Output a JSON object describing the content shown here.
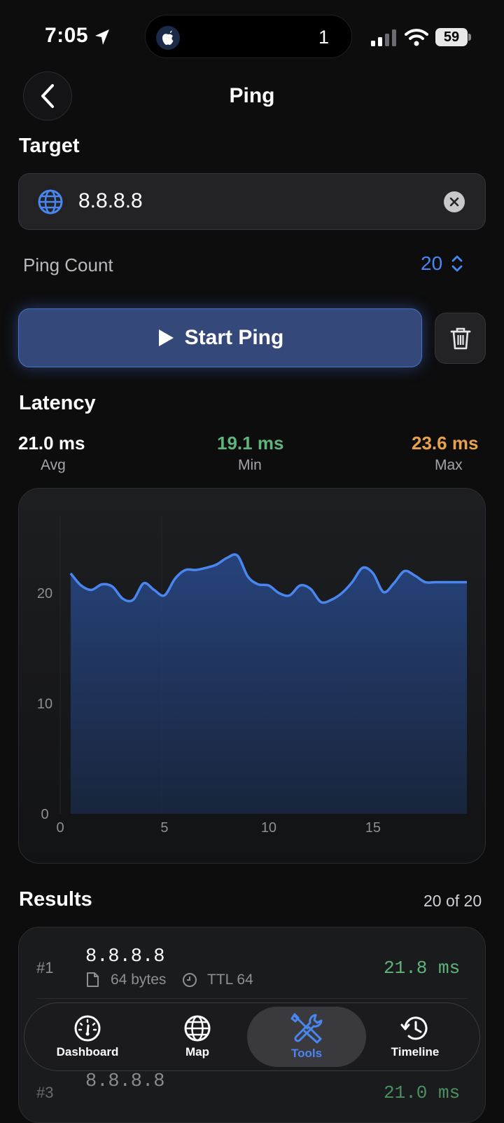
{
  "status": {
    "time": "7:05",
    "island_count": "1",
    "battery": "59"
  },
  "nav": {
    "title": "Ping"
  },
  "target": {
    "section": "Target",
    "value": "8.8.8.8"
  },
  "ping_count": {
    "label": "Ping Count",
    "value": "20"
  },
  "actions": {
    "start_label": "Start Ping"
  },
  "latency": {
    "section": "Latency",
    "avg": {
      "value": "21.0 ms",
      "label": "Avg",
      "color": "#ffffff"
    },
    "min": {
      "value": "19.1 ms",
      "label": "Min",
      "color": "#5fb37c"
    },
    "max": {
      "value": "23.6 ms",
      "label": "Max",
      "color": "#e9a24a"
    }
  },
  "chart_data": {
    "type": "area",
    "title": "",
    "xlabel": "",
    "ylabel": "",
    "x": [
      0.5,
      1,
      1.5,
      2,
      2.5,
      3,
      3.5,
      4,
      4.5,
      5,
      5.5,
      6,
      6.5,
      7,
      7.5,
      8,
      8.5,
      9,
      9.5,
      10,
      10.5,
      11,
      11.5,
      12,
      12.5,
      13,
      13.5,
      14,
      14.5,
      15,
      15.5,
      16,
      16.5,
      17,
      17.5,
      18,
      18.5,
      19,
      19.5
    ],
    "values": [
      21.8,
      20.7,
      20.3,
      20.8,
      20.6,
      19.5,
      19.4,
      20.9,
      20.3,
      19.8,
      21.3,
      22.1,
      22.1,
      22.3,
      22.6,
      23.2,
      23.4,
      21.5,
      20.8,
      20.7,
      20.0,
      19.8,
      20.7,
      20.4,
      19.2,
      19.4,
      20.0,
      21.0,
      22.3,
      21.8,
      20.1,
      20.9,
      22.0,
      21.6,
      21.0,
      21.0,
      21.0,
      21.0,
      21.0
    ],
    "xlim": [
      0,
      19.5
    ],
    "ylim": [
      0,
      27
    ],
    "xticks": [
      "0",
      "5",
      "10",
      "15"
    ],
    "yticks": [
      "0",
      "10",
      "20"
    ],
    "line_color": "#4a86f0",
    "grid": false
  },
  "results": {
    "section": "Results",
    "count": "20 of 20",
    "items": [
      {
        "index": "#1",
        "host": "8.8.8.8",
        "bytes": "64 bytes",
        "ttl": "TTL 64",
        "latency": "21.8 ms"
      },
      {
        "index": "#3",
        "host": "8.8.8.8",
        "latency": "21.0 ms"
      }
    ]
  },
  "tabs": [
    {
      "label": "Dashboard",
      "icon": "gauge-icon",
      "active": false
    },
    {
      "label": "Map",
      "icon": "globe-icon",
      "active": false
    },
    {
      "label": "Tools",
      "icon": "tools-icon",
      "active": true,
      "color": "#4a86f0"
    },
    {
      "label": "Timeline",
      "icon": "history-icon",
      "active": false
    }
  ]
}
